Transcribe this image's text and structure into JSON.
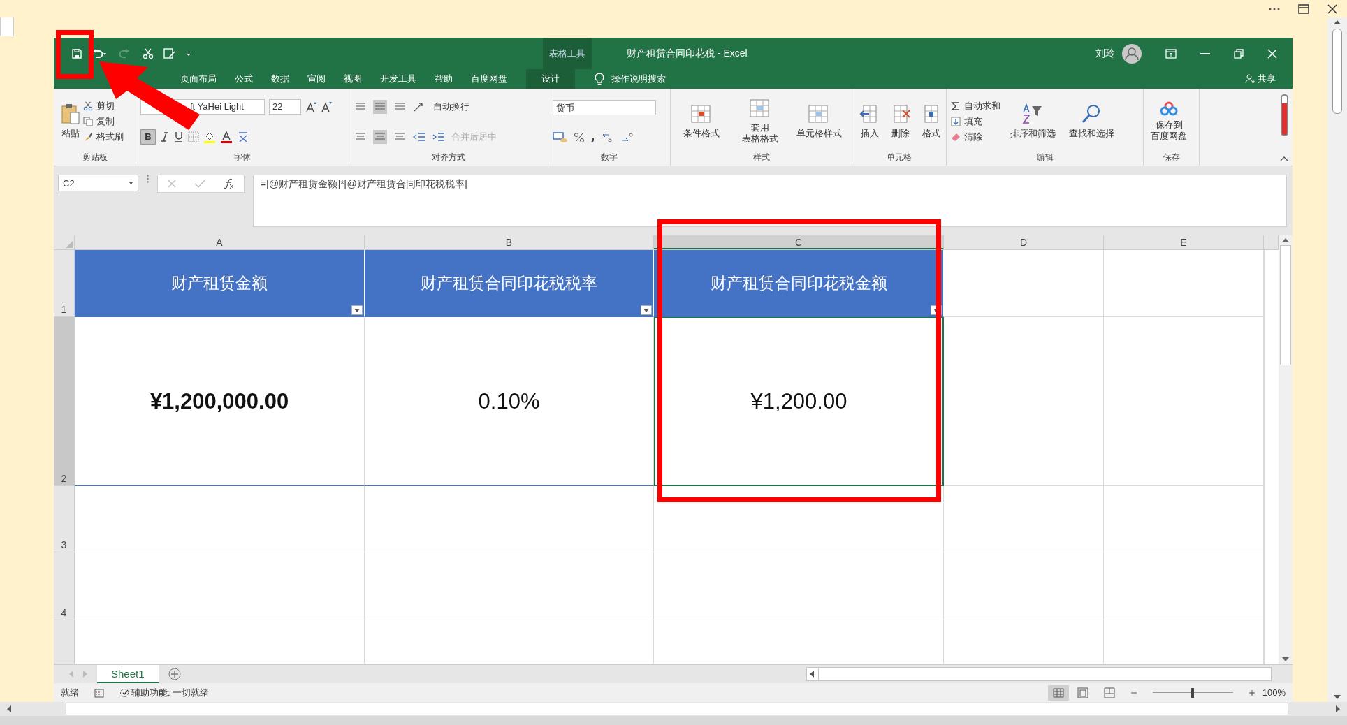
{
  "window": {
    "title": "财产租赁合同印花税  -  Excel",
    "context_tab": "表格工具",
    "user": "刘玲"
  },
  "tabs": [
    {
      "label": "页面布局",
      "selected": false
    },
    {
      "label": "公式",
      "selected": false
    },
    {
      "label": "数据",
      "selected": false
    },
    {
      "label": "审阅",
      "selected": false
    },
    {
      "label": "视图",
      "selected": false
    },
    {
      "label": "开发工具",
      "selected": false
    },
    {
      "label": "帮助",
      "selected": false
    },
    {
      "label": "百度网盘",
      "selected": false
    },
    {
      "label": "设计",
      "selected": false,
      "kind": "context"
    }
  ],
  "tell_me": "操作说明搜索",
  "share": "共享",
  "clipboard": {
    "label": "剪贴板",
    "paste": "粘贴",
    "cut": "剪切",
    "copy": "复制",
    "format_painter": "格式刷"
  },
  "font": {
    "label": "字体",
    "family": "ft YaHei Light",
    "size": "22",
    "bold": true,
    "bold_button": "B"
  },
  "alignment": {
    "label": "对齐方式",
    "wrap": "自动换行",
    "merge": "合并后居中"
  },
  "number": {
    "label": "数字",
    "format": "货币"
  },
  "styles": {
    "label": "样式",
    "items": [
      [
        "条件格式"
      ],
      [
        "套用",
        "表格格式"
      ],
      [
        "单元格样式"
      ]
    ]
  },
  "cells": {
    "label": "单元格",
    "items": [
      "插入",
      "删除",
      "格式"
    ]
  },
  "editing": {
    "label": "编辑",
    "autosum": "自动求和",
    "fill": "填充",
    "clear": "清除",
    "sort": "排序和筛选",
    "find": "查找和选择"
  },
  "save": {
    "label": "保存",
    "button": [
      "保存到",
      "百度网盘"
    ]
  },
  "formula_bar": {
    "name_box": "C2",
    "formula": "=[@财产租赁金额]*[@财产租赁合同印花税税率]"
  },
  "columns": [
    {
      "label": "A",
      "selected": false
    },
    {
      "label": "B",
      "selected": false
    },
    {
      "label": "C",
      "selected": true
    },
    {
      "label": "D",
      "selected": false
    },
    {
      "label": "E",
      "selected": false
    }
  ],
  "row_headers": [
    {
      "label": "1",
      "selected": false
    },
    {
      "label": "2",
      "selected": true
    },
    {
      "label": "3",
      "selected": false
    },
    {
      "label": "4",
      "selected": false
    }
  ],
  "table": {
    "headers": [
      "财产租赁金额",
      "财产租赁合同印花税税率",
      "财产租赁合同印花税金额"
    ],
    "cells": [
      {
        "text": "¥1,200,000.00",
        "bold": true
      },
      {
        "text": "0.10%",
        "bold": false
      },
      {
        "text": "¥1,200.00",
        "bold": false
      }
    ]
  },
  "sheets": [
    {
      "label": "Sheet1",
      "selected": true
    }
  ],
  "status_bar": {
    "ready": "就绪",
    "accessibility": "辅助功能: 一切就绪",
    "zoom": "100%",
    "zoom_slider": {
      "level": 0.5
    }
  }
}
